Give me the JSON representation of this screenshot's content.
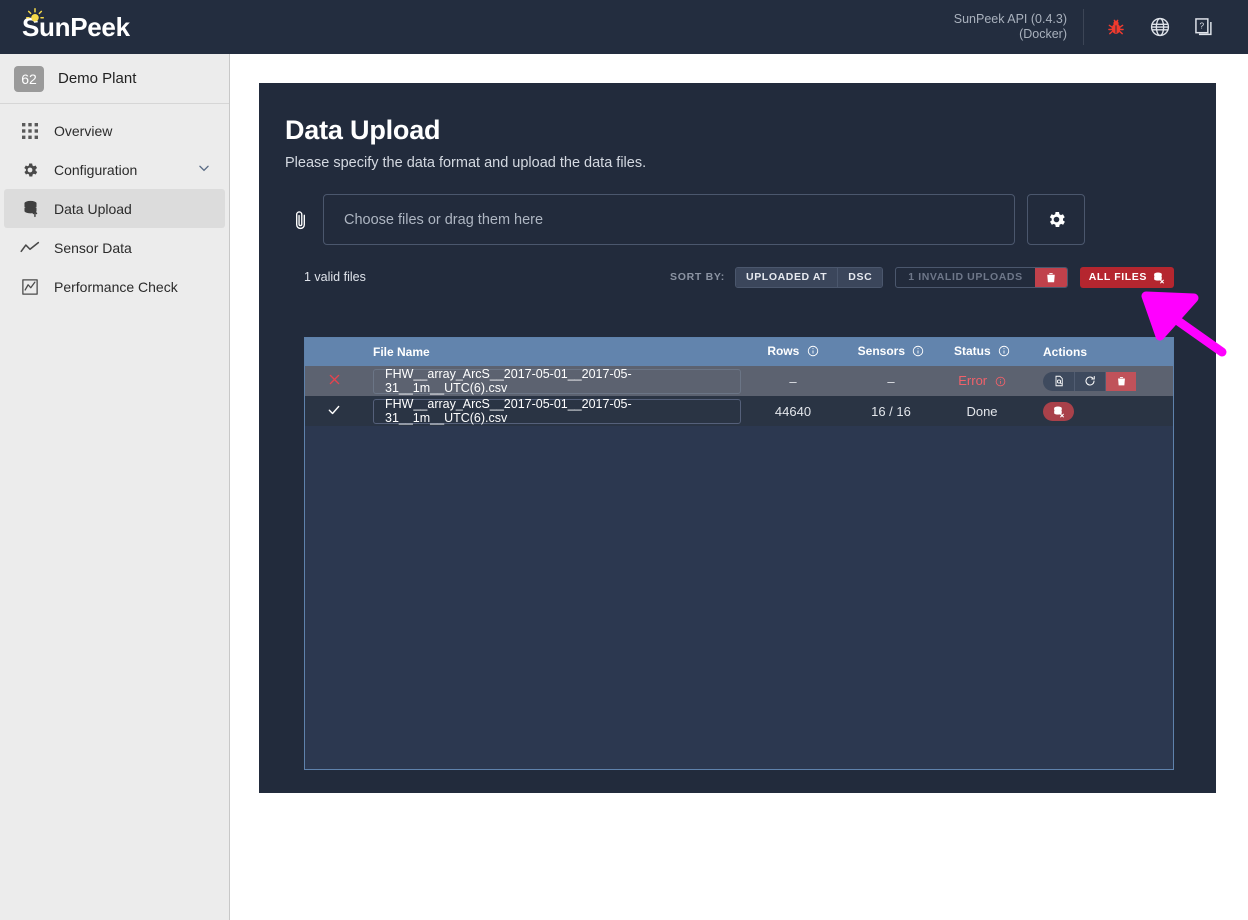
{
  "header": {
    "logo_text": "SunPeek",
    "logo_icon": "sun-icon",
    "api_line1": "SunPeek API (0.4.3)",
    "api_line2": "(Docker)",
    "icons": [
      {
        "name": "bug-icon",
        "color": "#f03a2e"
      },
      {
        "name": "globe-icon",
        "color": "#dfe3ea"
      },
      {
        "name": "help-docs-icon",
        "color": "#dfe3ea"
      }
    ]
  },
  "sidebar": {
    "plant": {
      "badge": "62",
      "name": "Demo Plant"
    },
    "items": [
      {
        "label": "Overview",
        "icon": "grid-icon",
        "active": false
      },
      {
        "label": "Configuration",
        "icon": "gear-icon",
        "active": false,
        "chevron": "chevron-down-icon"
      },
      {
        "label": "Data Upload",
        "icon": "database-upload-icon",
        "active": true
      },
      {
        "label": "Sensor Data",
        "icon": "line-chart-icon",
        "active": false
      },
      {
        "label": "Performance Check",
        "icon": "chart-box-icon",
        "active": false
      }
    ]
  },
  "page": {
    "title": "Data Upload",
    "subtitle": "Please specify the data format and upload the data files.",
    "upload": {
      "clip_icon": "paperclip-icon",
      "placeholder": "Choose files or drag them here",
      "settings_icon": "gear-icon"
    },
    "toolbar": {
      "valid_files": "1 valid files",
      "sort_by_label": "SORT BY:",
      "sort_field": "UPLOADED AT",
      "sort_dir": "DSC",
      "invalid_uploads": "1 INVALID UPLOADS",
      "invalid_delete_icon": "trash-icon",
      "all_files": "ALL FILES",
      "all_files_icon": "database-x-icon"
    },
    "table": {
      "columns": [
        {
          "key": "check",
          "label": ""
        },
        {
          "key": "name",
          "label": "File Name"
        },
        {
          "key": "rows",
          "label": "Rows",
          "info": true
        },
        {
          "key": "sensors",
          "label": "Sensors",
          "info": true
        },
        {
          "key": "status",
          "label": "Status",
          "info": true
        },
        {
          "key": "actions",
          "label": "Actions"
        }
      ],
      "rows": [
        {
          "state": "error",
          "check_icon": "x-icon",
          "file_name": "FHW__array_ArcS__2017-05-01__2017-05-31__1m__UTC(6).csv",
          "rows": "–",
          "sensors": "–",
          "status": "Error",
          "status_info": true,
          "actions": [
            "file-search-icon",
            "retry-icon",
            "trash-icon"
          ]
        },
        {
          "state": "ok",
          "check_icon": "check-icon",
          "file_name": "FHW__array_ArcS__2017-05-01__2017-05-31__1m__UTC(6).csv",
          "rows": "44640",
          "sensors": "16 / 16",
          "status": "Done",
          "status_info": false,
          "actions": [
            "database-x-icon"
          ]
        }
      ]
    },
    "annotation": {
      "name": "magenta-arrow",
      "color": "#ff00ff",
      "points_to": "ALL FILES"
    }
  },
  "colors": {
    "header_bg": "#232d3f",
    "sidebar_bg": "#ececec",
    "card_bg": "#222b3c",
    "table_bg": "#2c3850",
    "table_head": "#6284ad",
    "row_error": "#5c6270",
    "row_ok": "#2a3444",
    "danger": "#b5262f",
    "error_text": "#f0616a",
    "annotation": "#ff00ff"
  }
}
